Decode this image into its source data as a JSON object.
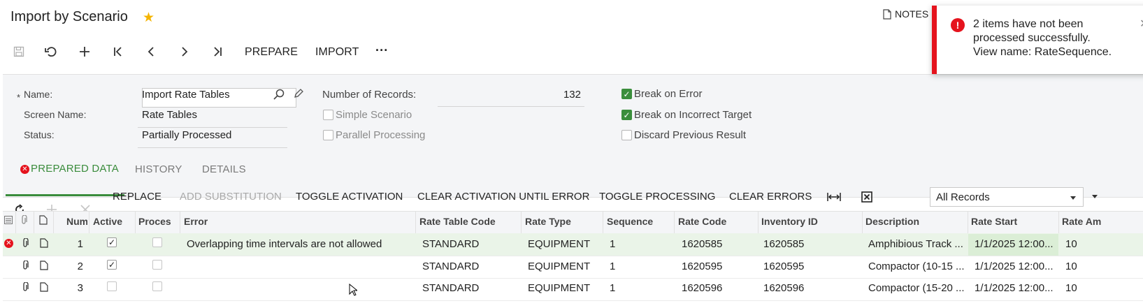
{
  "header": {
    "title": "Import by Scenario",
    "notes_label": "NOTES"
  },
  "toolbar": {
    "prepare_label": "PREPARE",
    "import_label": "IMPORT",
    "more_label": "···"
  },
  "toast": {
    "icon_glyph": "!",
    "message_line1": "2 items have not been",
    "message_line2": "processed successfully.",
    "message_line3": "View name: RateSequence.",
    "close_glyph": "✕"
  },
  "form": {
    "required_mark": "*",
    "name_label": "Name:",
    "name_value": "Import Rate Tables",
    "screen_name_label": "Screen Name:",
    "screen_name_value": "Rate Tables",
    "status_label": "Status:",
    "status_value": "Partially Processed",
    "records_label": "Number of Records:",
    "records_value": "132",
    "simple_scenario_label": "Simple Scenario",
    "simple_scenario_checked": false,
    "parallel_processing_label": "Parallel Processing",
    "parallel_processing_checked": false,
    "break_on_error_label": "Break on Error",
    "break_on_error_checked": true,
    "break_on_incorrect_target_label": "Break on Incorrect Target",
    "break_on_incorrect_target_checked": true,
    "discard_previous_result_label": "Discard Previous Result",
    "discard_previous_result_checked": false
  },
  "tabs": [
    {
      "label": "PREPARED DATA",
      "active": true,
      "error_glyph": "✕"
    },
    {
      "label": "HISTORY",
      "active": false
    },
    {
      "label": "DETAILS",
      "active": false
    }
  ],
  "grid_toolbar": {
    "replace": "REPLACE",
    "add_substitution": "ADD SUBSTITUTION",
    "toggle_activation": "TOGGLE ACTIVATION",
    "clear_activation_until_error": "CLEAR ACTIVATION UNTIL ERROR",
    "toggle_processing": "TOGGLE PROCESSING",
    "clear_errors": "CLEAR ERRORS",
    "filter_value": "All Records"
  },
  "grid": {
    "columns": [
      "Num",
      "Active",
      "Proces",
      "Error",
      "Rate Table Code",
      "Rate Type",
      "Sequence",
      "Rate Code",
      "Inventory ID",
      "Description",
      "Rate Start",
      "Rate Am"
    ],
    "rows": [
      {
        "num": "1",
        "active": true,
        "processed": false,
        "error": "Overlapping time intervals are not allowed",
        "rate_table_code": "STANDARD",
        "rate_type": "EQUIPMENT",
        "sequence": "1",
        "rate_code": "1620585",
        "inventory_id": "1620585",
        "description": "Amphibious Track ...",
        "rate_start": "1/1/2025 12:00...",
        "rate_amount": "10",
        "has_error": true,
        "error_glyph": "✕"
      },
      {
        "num": "2",
        "active": true,
        "processed": false,
        "error": "",
        "rate_table_code": "STANDARD",
        "rate_type": "EQUIPMENT",
        "sequence": "1",
        "rate_code": "1620595",
        "inventory_id": "1620595",
        "description": "Compactor (10-15 ...",
        "rate_start": "1/1/2025 12:00...",
        "rate_amount": "10",
        "has_error": false
      },
      {
        "num": "3",
        "active": false,
        "processed": false,
        "error": "",
        "rate_table_code": "STANDARD",
        "rate_type": "EQUIPMENT",
        "sequence": "1",
        "rate_code": "1620596",
        "inventory_id": "1620596",
        "description": "Compactor (15-20 ...",
        "rate_start": "1/1/2025 12:00...",
        "rate_amount": "10",
        "has_error": false
      }
    ]
  },
  "colors": {
    "accent_green": "#3a8c3c",
    "error_red": "#e5131d",
    "star_yellow": "#f5b400"
  }
}
